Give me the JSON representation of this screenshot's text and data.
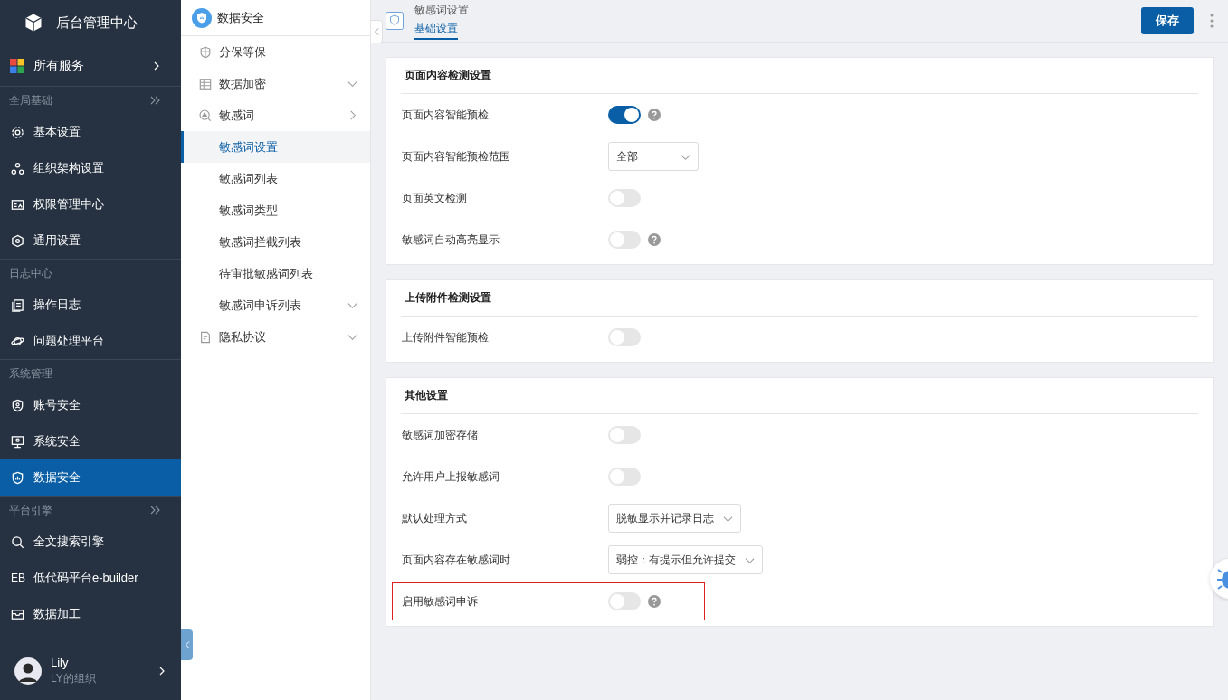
{
  "app": {
    "title": "后台管理中心"
  },
  "sidebar": {
    "all_services": "所有服务",
    "sections": [
      {
        "title": "全局基础",
        "collapsible": true,
        "items": [
          {
            "label": "基本设置",
            "selected": false
          },
          {
            "label": "组织架构设置",
            "selected": false
          },
          {
            "label": "权限管理中心",
            "selected": false
          },
          {
            "label": "通用设置",
            "selected": false
          }
        ]
      },
      {
        "title": "日志中心",
        "collapsible": false,
        "items": [
          {
            "label": "操作日志",
            "selected": false
          },
          {
            "label": "问题处理平台",
            "selected": false
          }
        ]
      },
      {
        "title": "系统管理",
        "collapsible": false,
        "items": [
          {
            "label": "账号安全",
            "selected": false
          },
          {
            "label": "系统安全",
            "selected": false
          },
          {
            "label": "数据安全",
            "selected": true
          }
        ]
      },
      {
        "title": "平台引擎",
        "collapsible": true,
        "items": [
          {
            "label": "全文搜索引擎",
            "selected": false
          },
          {
            "label": "低代码平台e-builder",
            "icon_text": "EB",
            "selected": false
          },
          {
            "label": "数据加工",
            "selected": false
          }
        ]
      }
    ],
    "user": {
      "name": "Lily",
      "org": "LY的组织"
    }
  },
  "submenu": {
    "title": "数据安全",
    "items": [
      {
        "label": "分保等保",
        "kind": "leaf",
        "selected": false
      },
      {
        "label": "数据加密",
        "kind": "collapsed",
        "selected": false
      },
      {
        "label": "敏感词",
        "kind": "expanded",
        "selected": false,
        "children": [
          {
            "label": "敏感词设置",
            "kind": "leaf",
            "selected": true
          },
          {
            "label": "敏感词列表",
            "kind": "leaf",
            "selected": false
          },
          {
            "label": "敏感词类型",
            "kind": "leaf",
            "selected": false
          },
          {
            "label": "敏感词拦截列表",
            "kind": "leaf",
            "selected": false
          },
          {
            "label": "待审批敏感词列表",
            "kind": "leaf",
            "selected": false
          },
          {
            "label": "敏感词申诉列表",
            "kind": "collapsed",
            "selected": false
          }
        ]
      },
      {
        "label": "隐私协议",
        "kind": "collapsed",
        "selected": false
      }
    ]
  },
  "header": {
    "title": "敏感词设置",
    "tabs": [
      {
        "label": "基础设置",
        "selected": true
      }
    ],
    "save": "保存"
  },
  "cards": [
    {
      "title": "页面内容检测设置",
      "rows": [
        {
          "label": "页面内容智能预检",
          "kind": "toggle",
          "on": true,
          "help": true,
          "highlighted": false
        },
        {
          "label": "页面内容智能预检范围",
          "kind": "select",
          "value": "全部",
          "help": false,
          "highlighted": false
        },
        {
          "label": "页面英文检测",
          "kind": "toggle",
          "on": false,
          "help": false,
          "highlighted": false
        },
        {
          "label": "敏感词自动高亮显示",
          "kind": "toggle",
          "on": false,
          "help": true,
          "highlighted": false
        }
      ]
    },
    {
      "title": "上传附件检测设置",
      "rows": [
        {
          "label": "上传附件智能预检",
          "kind": "toggle",
          "on": false,
          "help": false,
          "highlighted": false
        }
      ]
    },
    {
      "title": "其他设置",
      "rows": [
        {
          "label": "敏感词加密存储",
          "kind": "toggle",
          "on": false,
          "help": false,
          "highlighted": false
        },
        {
          "label": "允许用户上报敏感词",
          "kind": "toggle",
          "on": false,
          "help": false,
          "highlighted": false
        },
        {
          "label": "默认处理方式",
          "kind": "select",
          "value": "脱敏显示并记录日志",
          "help": false,
          "highlighted": false
        },
        {
          "label": "页面内容存在敏感词时",
          "kind": "select",
          "value": "弱控：有提示但允许提交",
          "help": false,
          "highlighted": false
        },
        {
          "label": "启用敏感词申诉",
          "kind": "toggle",
          "on": false,
          "help": true,
          "highlighted": true
        }
      ]
    }
  ]
}
